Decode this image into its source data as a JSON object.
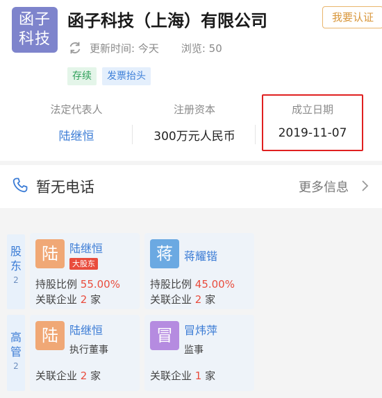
{
  "company": {
    "logo_line1": "函子",
    "logo_line2": "科技",
    "name": "函子科技（上海）有限公司",
    "claim_label": "我要认证",
    "update_text": "更新时间: 今天",
    "views_text": "浏览: 50",
    "tags": [
      "存续",
      "发票抬头"
    ]
  },
  "info": {
    "legal_rep_label": "法定代表人",
    "legal_rep_value": "陆继恒",
    "capital_label": "注册资本",
    "capital_value": "300万元人民币",
    "founded_label": "成立日期",
    "founded_value": "2019-11-07"
  },
  "contact": {
    "phone_text": "暂无电话",
    "more_label": "更多信息"
  },
  "shareholders": {
    "side_label_1": "股",
    "side_label_2": "东",
    "count": "2",
    "items": [
      {
        "avatar": "陆",
        "name": "陆继恒",
        "badge": "大股东",
        "ratio_label": "持股比例 ",
        "ratio_value": "55.00%",
        "related_label": "关联企业 ",
        "related_value": "2",
        "related_unit": " 家",
        "color": "#f0a876"
      },
      {
        "avatar": "蒋",
        "name": "蒋耀锴",
        "ratio_label": "持股比例 ",
        "ratio_value": "45.00%",
        "related_label": "关联企业 ",
        "related_value": "2",
        "related_unit": " 家",
        "color": "#6ba9e2"
      }
    ]
  },
  "executives": {
    "side_label_1": "高",
    "side_label_2": "管",
    "count": "2",
    "items": [
      {
        "avatar": "陆",
        "name": "陆继恒",
        "role": "执行董事",
        "related_label": "关联企业 ",
        "related_value": "2",
        "related_unit": " 家",
        "color": "#f0a876"
      },
      {
        "avatar": "冒",
        "name": "冒炜萍",
        "role": "监事",
        "related_label": "关联企业 ",
        "related_value": "1",
        "related_unit": " 家",
        "color": "#b58be0"
      }
    ]
  }
}
